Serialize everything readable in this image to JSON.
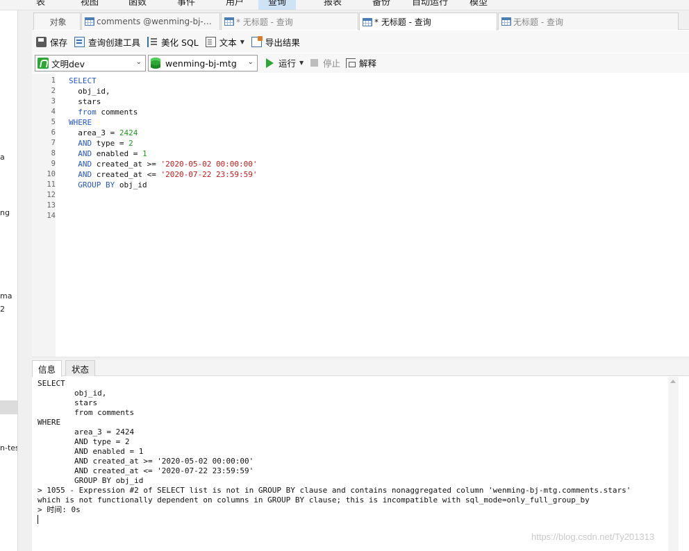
{
  "menu": {
    "items": [
      "表",
      "视图",
      "函数",
      "事件",
      "用户",
      "查询",
      "报表",
      "备份",
      "自动运行",
      "模型"
    ],
    "active": "查询"
  },
  "left_panel": {
    "fragments": [
      "a",
      "ng",
      "ma",
      "2",
      "n-test"
    ]
  },
  "tabs": [
    {
      "label": "对象",
      "icon": "none"
    },
    {
      "label": "comments @wenming-bj-m...",
      "icon": "table-icon"
    },
    {
      "label": "* 无标题 - 查询",
      "icon": "query-icon"
    },
    {
      "label": "* 无标题 - 查询",
      "icon": "query-icon"
    },
    {
      "label": "无标题 - 查询",
      "icon": "query-icon"
    }
  ],
  "toolbar": {
    "save": "保存",
    "query_builder": "查询创建工具",
    "beautify": "美化 SQL",
    "text": "文本",
    "export": "导出结果"
  },
  "runbar": {
    "connection": "文明dev",
    "database": "wenming-bj-mtg",
    "run": "运行",
    "stop": "停止",
    "explain": "解释"
  },
  "editor": {
    "line_numbers": [
      "1",
      "2",
      "3",
      "4",
      "5",
      "6",
      "7",
      "8",
      "9",
      "10",
      "11",
      "12",
      "13",
      "14"
    ],
    "lines": [
      [
        {
          "t": "SELECT",
          "c": "kw"
        }
      ],
      [
        {
          "t": "  obj_id,",
          "c": ""
        }
      ],
      [
        {
          "t": "  stars",
          "c": ""
        }
      ],
      [
        {
          "t": "  ",
          "c": ""
        },
        {
          "t": "from",
          "c": "kw"
        },
        {
          "t": " comments",
          "c": ""
        }
      ],
      [
        {
          "t": "WHERE",
          "c": "kw"
        }
      ],
      [
        {
          "t": "  area_3 = ",
          "c": ""
        },
        {
          "t": "2424",
          "c": "num"
        }
      ],
      [
        {
          "t": "  ",
          "c": ""
        },
        {
          "t": "AND",
          "c": "kw"
        },
        {
          "t": " type = ",
          "c": ""
        },
        {
          "t": "2",
          "c": "num"
        }
      ],
      [
        {
          "t": "  ",
          "c": ""
        },
        {
          "t": "AND",
          "c": "kw"
        },
        {
          "t": " enabled = ",
          "c": ""
        },
        {
          "t": "1",
          "c": "num"
        }
      ],
      [
        {
          "t": "  ",
          "c": ""
        },
        {
          "t": "AND",
          "c": "kw"
        },
        {
          "t": " created_at >= ",
          "c": ""
        },
        {
          "t": "'2020-05-02 00:00:00'",
          "c": "str"
        }
      ],
      [
        {
          "t": "  ",
          "c": ""
        },
        {
          "t": "AND",
          "c": "kw"
        },
        {
          "t": " created_at <= ",
          "c": ""
        },
        {
          "t": "'2020-07-22 23:59:59'",
          "c": "str"
        }
      ],
      [
        {
          "t": "  ",
          "c": ""
        },
        {
          "t": "GROUP BY",
          "c": "kw"
        },
        {
          "t": " obj_id",
          "c": ""
        }
      ],
      [],
      [],
      []
    ]
  },
  "result_tabs": [
    "信息",
    "状态"
  ],
  "messages": [
    "SELECT",
    "        obj_id,",
    "        stars",
    "        from comments",
    "WHERE",
    "        area_3 = 2424",
    "        AND type = 2",
    "        AND enabled = 1",
    "        AND created_at >= '2020-05-02 00:00:00'",
    "        AND created_at <= '2020-07-22 23:59:59'",
    "        GROUP BY obj_id",
    "> 1055 - Expression #2 of SELECT list is not in GROUP BY clause and contains nonaggregated column 'wenming-bj-mtg.comments.stars'",
    "which is not functionally dependent on columns in GROUP BY clause; this is incompatible with sql_mode=only_full_group_by",
    "> 时间: 0s"
  ],
  "watermark": "https://blog.csdn.net/Ty201313",
  "colors": {
    "keyword": "#2456c8",
    "number": "#1c9a1c",
    "string": "#c41a1a",
    "run_green": "#2aa833",
    "active_menu": "#cfe3f7"
  }
}
